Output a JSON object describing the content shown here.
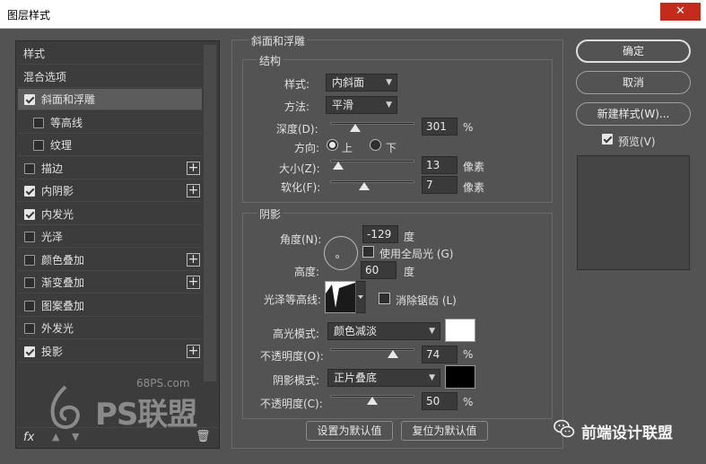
{
  "window": {
    "title": "图层样式",
    "close_label": "✕"
  },
  "left_panel": {
    "items": [
      {
        "label": "样式",
        "checkbox": false,
        "checked": false,
        "plus": false,
        "sub": false,
        "selected": false
      },
      {
        "label": "混合选项",
        "checkbox": false,
        "checked": false,
        "plus": false,
        "sub": false,
        "selected": false
      },
      {
        "label": "斜面和浮雕",
        "checkbox": true,
        "checked": true,
        "plus": false,
        "sub": false,
        "selected": true
      },
      {
        "label": "等高线",
        "checkbox": true,
        "checked": false,
        "plus": false,
        "sub": true,
        "selected": false
      },
      {
        "label": "纹理",
        "checkbox": true,
        "checked": false,
        "plus": false,
        "sub": true,
        "selected": false
      },
      {
        "label": "描边",
        "checkbox": true,
        "checked": false,
        "plus": true,
        "sub": false,
        "selected": false
      },
      {
        "label": "内阴影",
        "checkbox": true,
        "checked": true,
        "plus": true,
        "sub": false,
        "selected": false
      },
      {
        "label": "内发光",
        "checkbox": true,
        "checked": true,
        "plus": false,
        "sub": false,
        "selected": false
      },
      {
        "label": "光泽",
        "checkbox": true,
        "checked": false,
        "plus": false,
        "sub": false,
        "selected": false
      },
      {
        "label": "颜色叠加",
        "checkbox": true,
        "checked": false,
        "plus": true,
        "sub": false,
        "selected": false
      },
      {
        "label": "渐变叠加",
        "checkbox": true,
        "checked": false,
        "plus": true,
        "sub": false,
        "selected": false
      },
      {
        "label": "图案叠加",
        "checkbox": true,
        "checked": false,
        "plus": false,
        "sub": false,
        "selected": false
      },
      {
        "label": "外发光",
        "checkbox": true,
        "checked": false,
        "plus": false,
        "sub": false,
        "selected": false
      },
      {
        "label": "投影",
        "checkbox": true,
        "checked": true,
        "plus": true,
        "sub": false,
        "selected": false
      }
    ],
    "footer": {
      "fx_label": "fx",
      "up_icon": "▲",
      "down_icon": "▼",
      "trash_icon": "🗑"
    }
  },
  "watermark": {
    "url": "68PS.com",
    "brand": "PS联盟"
  },
  "bevel": {
    "section_title": "斜面和浮雕",
    "structure": {
      "title": "结构",
      "style_label": "样式:",
      "style_value": "内斜面",
      "technique_label": "方法:",
      "technique_value": "平滑",
      "depth_label": "深度(D):",
      "depth_value": "301",
      "depth_unit": "%",
      "depth_slider": 0.3,
      "direction_label": "方向:",
      "direction_up": "上",
      "direction_down": "下",
      "direction_selected": "up",
      "size_label": "大小(Z):",
      "size_value": "13",
      "size_unit": "像素",
      "size_slider": 0.1,
      "soften_label": "软化(F):",
      "soften_value": "7",
      "soften_unit": "像素",
      "soften_slider": 0.4
    },
    "shading": {
      "title": "阴影",
      "angle_label": "角度(N):",
      "angle_value": "-129",
      "angle_unit": "度",
      "global_light_label": "使用全局光 (G)",
      "global_light_checked": false,
      "altitude_label": "高度:",
      "altitude_value": "60",
      "altitude_unit": "度",
      "gloss_contour_label": "光泽等高线:",
      "antialiased_label": "消除锯齿 (L)",
      "antialiased_checked": false,
      "highlight_mode_label": "高光模式:",
      "highlight_mode_value": "颜色减淡",
      "highlight_color": "#ffffff",
      "highlight_opacity_label": "不透明度(O):",
      "highlight_opacity_value": "74",
      "highlight_opacity_unit": "%",
      "highlight_opacity_slider": 0.74,
      "shadow_mode_label": "阴影模式:",
      "shadow_mode_value": "正片叠底",
      "shadow_color": "#000000",
      "shadow_opacity_label": "不透明度(C):",
      "shadow_opacity_value": "50",
      "shadow_opacity_unit": "%",
      "shadow_opacity_slider": 0.5
    },
    "make_default_label": "设置为默认值",
    "reset_default_label": "复位为默认值"
  },
  "right_panel": {
    "ok_label": "确定",
    "cancel_label": "取消",
    "new_style_label": "新建样式(W)...",
    "preview_label": "预览(V)",
    "preview_checked": true
  },
  "footer_brand": {
    "text": "前端设计联盟",
    "icon": "wechat-icon"
  }
}
